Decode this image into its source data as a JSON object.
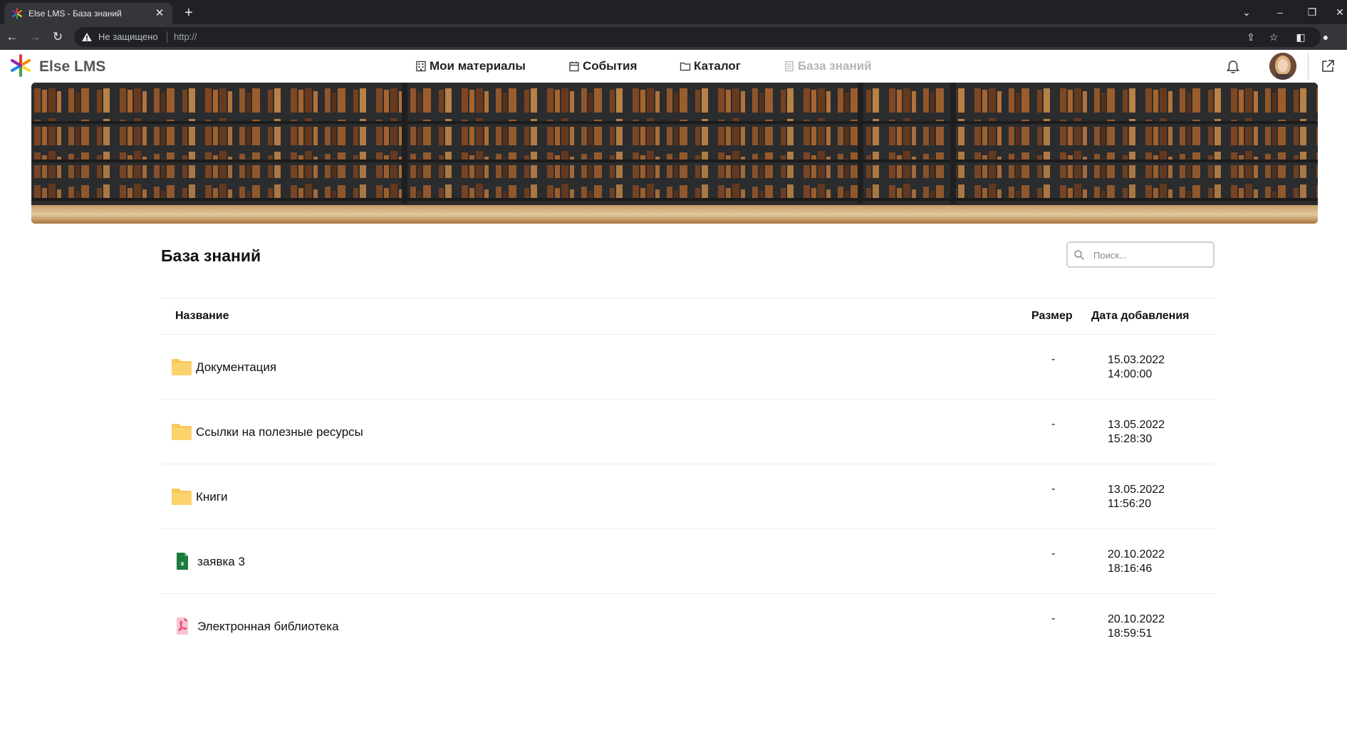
{
  "browser": {
    "tab_title": "Else LMS - База знаний",
    "security_label": "Не защищено",
    "url": "http://"
  },
  "app": {
    "brand": "Else LMS",
    "nav": [
      {
        "label": "Мои материалы",
        "icon": "building-icon",
        "active": false
      },
      {
        "label": "События",
        "icon": "calendar-icon",
        "active": false
      },
      {
        "label": "Каталог",
        "icon": "folder-icon",
        "active": false
      },
      {
        "label": "База знаний",
        "icon": "book-icon",
        "active": true
      }
    ]
  },
  "page": {
    "title": "База знаний",
    "search_placeholder": "Поиск..."
  },
  "table": {
    "headers": {
      "name": "Название",
      "size": "Размер",
      "date": "Дата добавления"
    },
    "rows": [
      {
        "type": "folder",
        "icon": "folder-icon",
        "name": "Документация",
        "size": "-",
        "date": "15.03.2022",
        "time": "14:00:00"
      },
      {
        "type": "folder",
        "icon": "folder-icon",
        "name": "Ссылки на полезные ресурсы",
        "size": "-",
        "date": "13.05.2022",
        "time": "15:28:30"
      },
      {
        "type": "folder",
        "icon": "folder-icon",
        "name": "Книги",
        "size": "-",
        "date": "13.05.2022",
        "time": "11:56:20"
      },
      {
        "type": "excel",
        "icon": "excel-file-icon",
        "name": "заявка 3",
        "size": "-",
        "date": "20.10.2022",
        "time": "18:16:46"
      },
      {
        "type": "pdf",
        "icon": "pdf-file-icon",
        "name": "Электронная библиотека",
        "size": "-",
        "date": "20.10.2022",
        "time": "18:59:51"
      }
    ]
  },
  "colors": {
    "folder": "#f9c85a",
    "excel": "#1f7a3e",
    "pdf": "#e8476a",
    "nav_active": "#b5b5b5"
  }
}
